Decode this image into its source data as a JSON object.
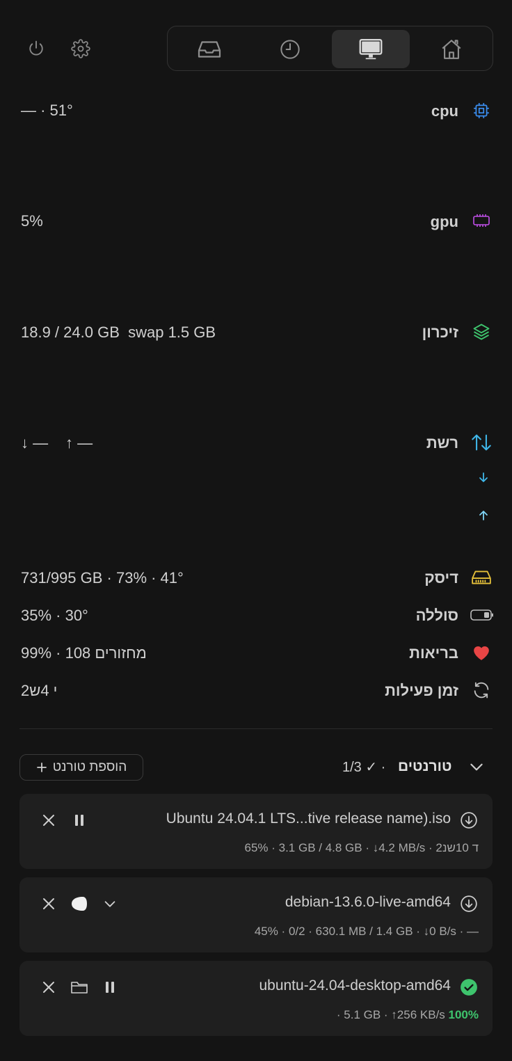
{
  "topbar": {
    "power_icon": "power-icon",
    "settings_icon": "gear-icon",
    "tabs": [
      {
        "icon": "inbox-icon",
        "active": false
      },
      {
        "icon": "clock-icon",
        "active": false
      },
      {
        "icon": "monitor-icon",
        "active": true
      },
      {
        "icon": "home-icon",
        "active": false
      }
    ]
  },
  "metrics": {
    "cpu": {
      "label": "cpu",
      "value": "— · 51°",
      "color": "#3b8ef0"
    },
    "gpu": {
      "label": "gpu",
      "value": "5%",
      "color": "#c04ee8"
    },
    "memory": {
      "label": "זיכרון",
      "value": "18.9 / 24.0 GB  swap 1.5 GB",
      "color": "#3ec46d"
    },
    "network": {
      "label": "רשת",
      "down": "↓ —",
      "up": "↑ —",
      "color": "#3fb6e8"
    },
    "disk": {
      "label": "דיסק",
      "value": "731/995 GB · 73% · 41°",
      "color": "#e6c13a"
    },
    "battery": {
      "label": "סוללה",
      "value": "35% · 30°"
    },
    "health": {
      "label": "בריאות",
      "value": "99% · 108 מחזורים",
      "color": "#e84545"
    },
    "uptime": {
      "label": "זמן פעילות",
      "value": "2י 4ש"
    }
  },
  "torrents": {
    "title": "טורנטים",
    "summary": "1/3 ✓ ·",
    "add_label": "הוספת טורנט",
    "items": [
      {
        "name": "Ubuntu 24.04.1 LTS...tive release name).iso",
        "stats": "65% · 3.1 GB / 4.8 GB · ↓4.2 MB/s · ד 10שנ2",
        "status": "downloading"
      },
      {
        "name": "debian-13.6.0-live-amd64",
        "stats": "45% · 0/2 · 630.1 MB / 1.4 GB · ↓0 B/s · —",
        "status": "downloading"
      },
      {
        "name": "ubuntu-24.04-desktop-amd64",
        "stats_prefix": "· 5.1 GB · ↑256 KB/s ",
        "stats_pct": "100%",
        "status": "complete",
        "pct_color": "#3ec46d"
      }
    ]
  }
}
